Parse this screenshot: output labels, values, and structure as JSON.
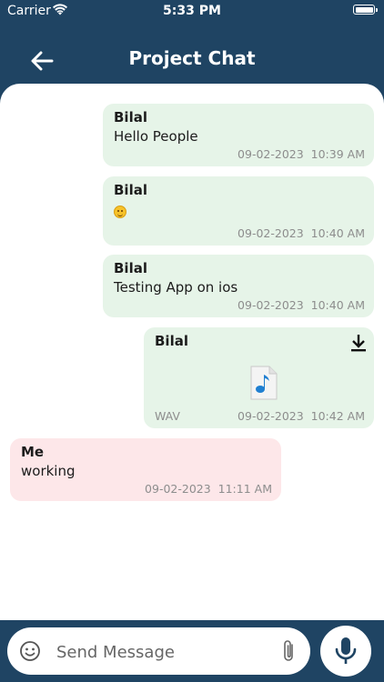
{
  "status_bar": {
    "carrier": "Carrier",
    "time": "5:33 PM"
  },
  "header": {
    "title": "Project Chat",
    "back_icon": "arrow-left-icon"
  },
  "messages": [
    {
      "sender": "Bilal",
      "text": "Hello People",
      "date": "09-02-2023",
      "time": "10:39 AM",
      "direction": "incoming"
    },
    {
      "sender": "Bilal",
      "emoji": "smiling-face-emoji",
      "date": "09-02-2023",
      "time": "10:40 AM",
      "direction": "incoming"
    },
    {
      "sender": "Bilal",
      "text": "Testing App on ios",
      "date": "09-02-2023",
      "time": "10:40 AM",
      "direction": "incoming"
    },
    {
      "sender": "Bilal",
      "file_type": "WAV",
      "file_icon": "audio-file-icon",
      "date": "09-02-2023",
      "time": "10:42 AM",
      "direction": "incoming"
    },
    {
      "sender": "Me",
      "text": "working",
      "date": "09-02-2023",
      "time": "11:11 AM",
      "direction": "outgoing"
    }
  ],
  "input": {
    "placeholder": "Send Message",
    "value": ""
  },
  "colors": {
    "header_bg": "#1f4463",
    "incoming_bubble": "#e6f4e8",
    "outgoing_bubble": "#fde7e9",
    "meta_text": "#8d8d8d"
  }
}
